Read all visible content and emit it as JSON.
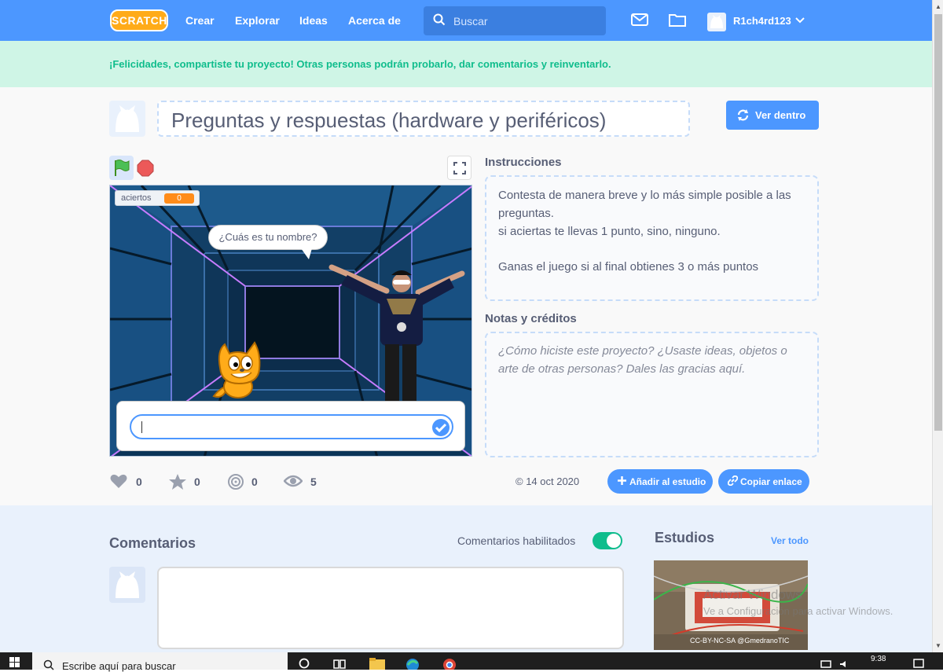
{
  "nav": {
    "logo": "SCRATCH",
    "links": [
      "Crear",
      "Explorar",
      "Ideas",
      "Acerca de"
    ],
    "search_placeholder": "Buscar",
    "username": "R1ch4rd123"
  },
  "banner": {
    "text": "¡Felicidades, compartiste tu proyecto! Otras personas podrán probarlo, dar comentarios y reinventarlo."
  },
  "project": {
    "title": "Preguntas y respuestas (hardware y periféricos)",
    "see_inside_label": "Ver dentro"
  },
  "stage": {
    "variable_name": "aciertos",
    "variable_value": "0",
    "speech_bubble": "¿Cuás es tu nombre?",
    "answer_value": ""
  },
  "stats": {
    "loves": "0",
    "favorites": "0",
    "remixes": "0",
    "views": "5"
  },
  "meta": {
    "date": "© 14 oct 2020",
    "add_to_studio_label": "Añadir al estudio",
    "copy_link_label": "Copiar enlace"
  },
  "instructions": {
    "heading": "Instrucciones",
    "lines": [
      "Contesta de manera breve y lo más simple posible a las",
      "preguntas.",
      "si aciertas te llevas 1 punto, sino, ninguno.",
      "Ganas el juego si al final obtienes 3 o más puntos"
    ]
  },
  "notes": {
    "heading": "Notas y créditos",
    "placeholder_lines": [
      "¿Cómo hiciste este proyecto? ¿Usaste ideas, objetos o",
      "arte de otras personas? Dales las gracias aquí."
    ]
  },
  "comments": {
    "heading": "Comentarios",
    "toggle_label": "Comentarios habilitados",
    "toggle_on": true
  },
  "studios": {
    "heading": "Estudios",
    "see_all_label": "Ver todo",
    "thumb_caption": "CC-BY-NC-SA @GmedranoTIC"
  },
  "watermark": {
    "line1": "Activar Windows",
    "line2": "Ve a Configuración para activar Windows."
  },
  "taskbar": {
    "search_placeholder": "Escribe aquí para buscar",
    "time": "9:38"
  },
  "colors": {
    "brand_blue": "#4c97ff",
    "banner_green_bg": "#cff5e6",
    "banner_green_text": "#0fbd8c",
    "variable_orange": "#ff8c1a",
    "toggle_green": "#0fbd8c"
  }
}
